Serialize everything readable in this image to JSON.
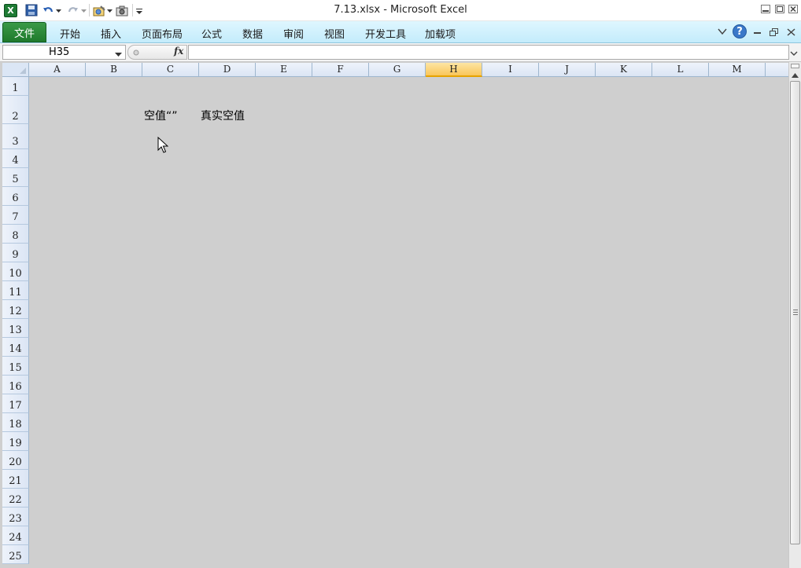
{
  "window": {
    "title": "7.13.xlsx  -  Microsoft Excel",
    "app_icon": "excel-icon"
  },
  "quick_access": {
    "items": [
      "save-icon",
      "undo-icon",
      "redo-icon",
      "tool-icon",
      "camera-icon",
      "customize-icon"
    ]
  },
  "ribbon": {
    "file_tab": "文件",
    "tabs": [
      "开始",
      "插入",
      "页面布局",
      "公式",
      "数据",
      "审阅",
      "视图",
      "开发工具",
      "加载项"
    ]
  },
  "formula_bar": {
    "name_box": "H35",
    "fx_label": "fx",
    "formula": ""
  },
  "grid": {
    "columns": [
      "A",
      "B",
      "C",
      "D",
      "E",
      "F",
      "G",
      "H",
      "I",
      "J",
      "K",
      "L",
      "M"
    ],
    "active_column": "H",
    "rows": [
      "1",
      "2",
      "3",
      "4",
      "5",
      "6",
      "7",
      "8",
      "9",
      "10",
      "11",
      "12",
      "13",
      "14",
      "15",
      "16",
      "17",
      "18",
      "19",
      "20",
      "21",
      "22",
      "23",
      "24",
      "25"
    ],
    "cells": {
      "C2": "空值“”",
      "D2": "真实空值"
    }
  },
  "colors": {
    "ribbon_bg": "#c4ecfb",
    "file_tab": "#1f7a2c",
    "grid_bg": "#cfcfcf",
    "header_bg": "#dbe5f4",
    "active_header": "#f9c65a"
  }
}
